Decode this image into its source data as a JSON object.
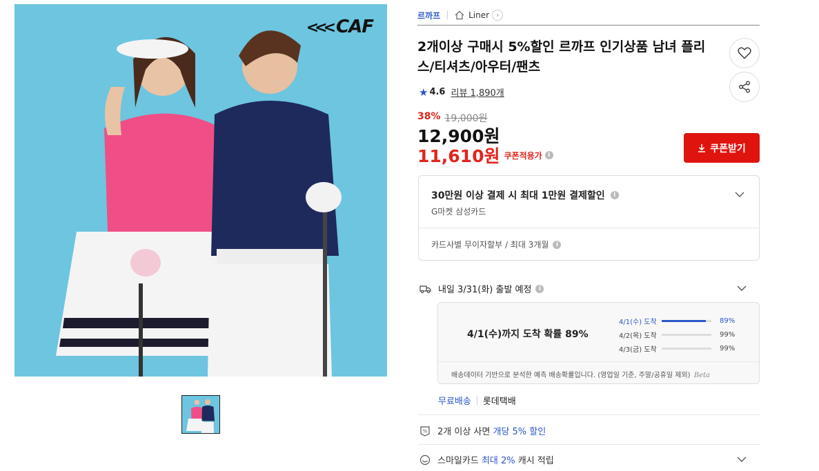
{
  "hero": {
    "brand_logo": "CAF"
  },
  "breadcrumb": {
    "shop": "르까프",
    "category": "Liner",
    "more_icon": "chevron-right-icon"
  },
  "product": {
    "title": "2개이상 구매시 5%할인 르까프 인기상품 남녀 플리스/티셔츠/아우터/팬츠",
    "rating": "4.6",
    "review_label": "리뷰 1,890개",
    "discount_rate": "38%",
    "original_price": "19,000원",
    "sale_price": "12,900원",
    "coupon_price": "11,610원",
    "coupon_tag": "쿠폰적용가"
  },
  "actions": {
    "coupon_button": "쿠폰받기",
    "like_icon": "heart-icon",
    "share_icon": "share-icon"
  },
  "card_benefit": {
    "headline": "30만원 이상 결제 시 최대 1만원 결제할인",
    "card_name": "G마켓 삼성카드",
    "installment": "카드사별 무이자할부 / 최대 3개월"
  },
  "shipping": {
    "dispatch": "내일 3/31(화) 출발 예정",
    "prediction_headline": "4/1(수)까지 도착 확률 89%",
    "rows": [
      {
        "label": "4/1(수) 도착",
        "pct": "89%",
        "value": 0.89
      },
      {
        "label": "4/2(목) 도착",
        "pct": "99%",
        "value": 0.0
      },
      {
        "label": "4/3(금) 도착",
        "pct": "99%",
        "value": 0.0
      }
    ],
    "note": "배송데이터 기반으로 분석한 예측 배송확률입니다. (영업일 기준, 주말/공휴일 제외)",
    "beta": "Beta",
    "free_shipping": "무료배송",
    "carrier": "롯데택배"
  },
  "benefits": {
    "multi_buy_prefix": "2개 이상 사면 ",
    "multi_buy_highlight": "개당 5% 할인",
    "smile_prefix": "스마일카드 ",
    "smile_highlight": "최대 2%",
    "smile_suffix": " 캐시 적립"
  },
  "colors": {
    "accent": "#2b56c9",
    "sale": "#e0251b",
    "coupon_button": "#e0140f"
  }
}
